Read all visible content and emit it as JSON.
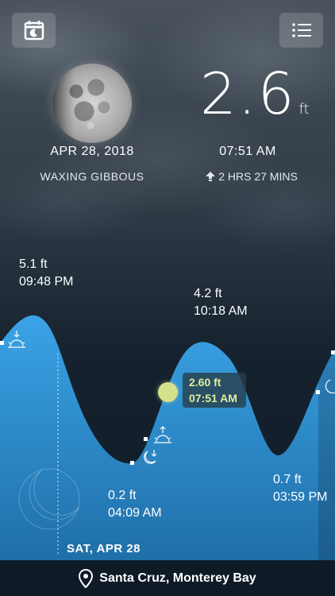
{
  "current": {
    "height_value": "2.6",
    "height_unit": "ft",
    "date": "APR 28, 2018",
    "time": "07:51 AM",
    "moon_phase": "WAXING GIBBOUS",
    "time_until": "2 HRS 27 MINS"
  },
  "tide_markers": [
    {
      "height": "5.1 ft",
      "time": "09:48 PM"
    },
    {
      "height": "4.2 ft",
      "time": "10:18 AM"
    },
    {
      "height": "0.2 ft",
      "time": "04:09 AM"
    },
    {
      "height": "0.7 ft",
      "time": "03:59 PM"
    }
  ],
  "current_marker": {
    "height": "2.60 ft",
    "time": "07:51 AM"
  },
  "day_label": "SAT, APR 28",
  "location": "Santa Cruz, Monterey Bay",
  "icons": {
    "calendar": "calendar-icon",
    "menu": "list-menu-icon",
    "location": "location-pin-icon",
    "sunset": "sunset-icon",
    "sunrise": "sunrise-icon",
    "moonrise": "moonrise-icon",
    "moonset": "moonset-icon",
    "up": "up-arrow-icon"
  },
  "colors": {
    "tide_fill": "#3a9ee0",
    "highlight": "#d4e08a",
    "background": "#0f1d29"
  }
}
